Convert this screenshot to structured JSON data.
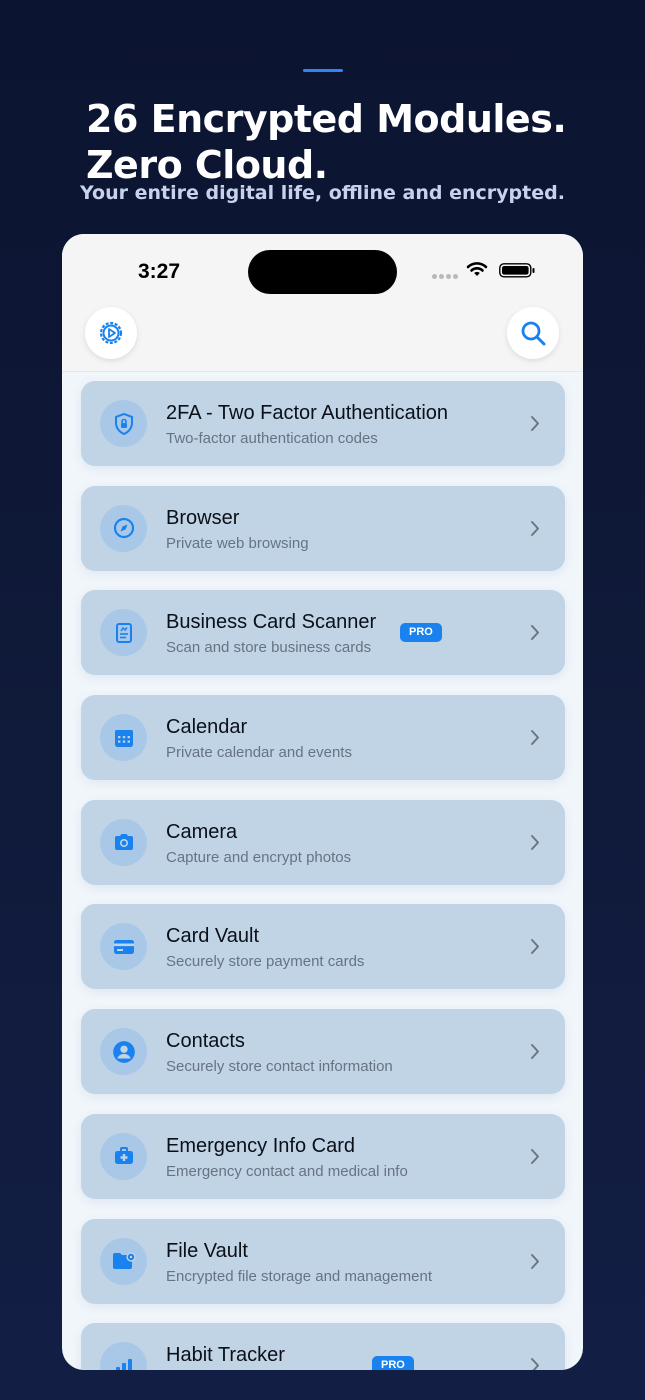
{
  "header": {
    "headline_line1": "26 Encrypted Modules.",
    "headline_line2": "Zero Cloud.",
    "subhead": "Your entire digital life, offline and encrypted."
  },
  "status_bar": {
    "time": "3:27"
  },
  "toolbar": {
    "settings_icon": "settings-gear-icon",
    "search_icon": "search-icon"
  },
  "colors": {
    "accent": "#1a82ee",
    "card": "#c0d4e6",
    "background": "#0b1430"
  },
  "modules": [
    {
      "title": "2FA - Two Factor Authentication",
      "subtitle": "Two-factor authentication codes",
      "icon": "shield-lock-icon"
    },
    {
      "title": "Browser",
      "subtitle": "Private web browsing",
      "icon": "compass-icon"
    },
    {
      "title": "Business Card Scanner",
      "subtitle": "Scan and store business cards",
      "icon": "document-scan-icon",
      "badge": "PRO"
    },
    {
      "title": "Calendar",
      "subtitle": "Private calendar and events",
      "icon": "calendar-icon"
    },
    {
      "title": "Camera",
      "subtitle": "Capture and encrypt photos",
      "icon": "camera-icon"
    },
    {
      "title": "Card Vault",
      "subtitle": "Securely store payment cards",
      "icon": "credit-card-icon"
    },
    {
      "title": "Contacts",
      "subtitle": "Securely store contact information",
      "icon": "person-circle-icon"
    },
    {
      "title": "Emergency Info Card",
      "subtitle": "Emergency contact and medical info",
      "icon": "medical-kit-icon"
    },
    {
      "title": "File Vault",
      "subtitle": "Encrypted file storage and management",
      "icon": "folder-gear-icon"
    },
    {
      "title": "Habit Tracker",
      "subtitle": "",
      "icon": "bar-chart-icon",
      "badge": "PRO"
    }
  ]
}
